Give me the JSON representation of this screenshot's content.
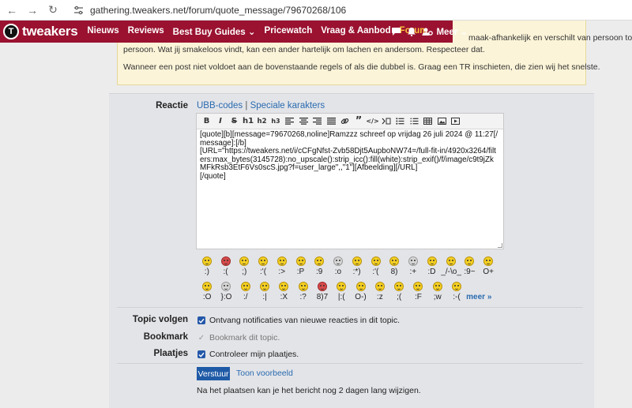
{
  "browser": {
    "url": "gathering.tweakers.net/forum/quote_message/79670268/106"
  },
  "nav": {
    "logo_text": "tweakers",
    "items": [
      "Nieuws",
      "Reviews",
      "Best Buy Guides ⌄",
      "Pricewatch",
      "Vraag & Aanbod",
      "Forum",
      "Meer ⌄"
    ],
    "active_index": 5
  },
  "notice": {
    "line1": "maak-afhankelijk en verschilt van persoon tot",
    "line2": "persoon. Wat jij smakeloos vindt, kan een ander hartelijk om lachen en andersom. Respecteer dat.",
    "line3": "Wanneer een post niet voldoet aan de bovenstaande regels of als die dubbel is. Graag een TR inschieten, die zien wij het snelste."
  },
  "form": {
    "reactie_label": "Reactie",
    "ubb_link": "UBB-codes",
    "link_sep": " | ",
    "special_link": "Speciale karakters",
    "toolbar": [
      "B",
      "I",
      "S",
      "h1",
      "h2",
      "h3"
    ],
    "textarea_value": "[quote][b][message=79670268,noline]Ramzzz schreef op vrijdag 26 juli 2024 @ 11:27[/message]:[/b]\n[URL=\"https://tweakers.net/i/cCFgNfst-Zvb58Djt5AupboNW74=/full-fit-in/4920x3264/filters:max_bytes(3145728):no_upscale():strip_icc():fill(white):strip_exif()/f/image/c9t9jZkMFkRsb3EtF6Vs0scS.jpg?f=user_large\",,\"1\"][Afbeelding][/URL]\n[/quote]",
    "smiley_codes_row1": [
      ":)",
      ":(",
      ";)",
      ":'(",
      ":>",
      ":P",
      ":9",
      ":o",
      ":*)",
      ":'(",
      "8)",
      ":+",
      ":D",
      "_/-\\o_",
      ":9~",
      "O+"
    ],
    "smiley_codes_row2": [
      ":O",
      "}:O",
      ":/",
      ":|",
      ":X",
      ":?",
      "8)7",
      "|:(",
      "O-)",
      ":z",
      ";(",
      ":F",
      ";w",
      ":-(",
      "meer »"
    ],
    "topic_label": "Topic volgen",
    "topic_option": "Ontvang notificaties van nieuwe reacties in dit topic.",
    "bookmark_label": "Bookmark",
    "bookmark_option": "Bookmark dit topic.",
    "plaatjes_label": "Plaatjes",
    "plaatjes_option": "Controleer mijn plaatjes.",
    "submit_label": "Verstuur",
    "preview_label": "Toon voorbeeld",
    "edit_note": "Na het plaatsen kan je het bericht nog 2 dagen lang wijzigen."
  },
  "colors": {
    "nav_bg": "#9a1230",
    "active": "#f7c23b",
    "link": "#2a6bb0",
    "button": "#1f5aa6"
  }
}
